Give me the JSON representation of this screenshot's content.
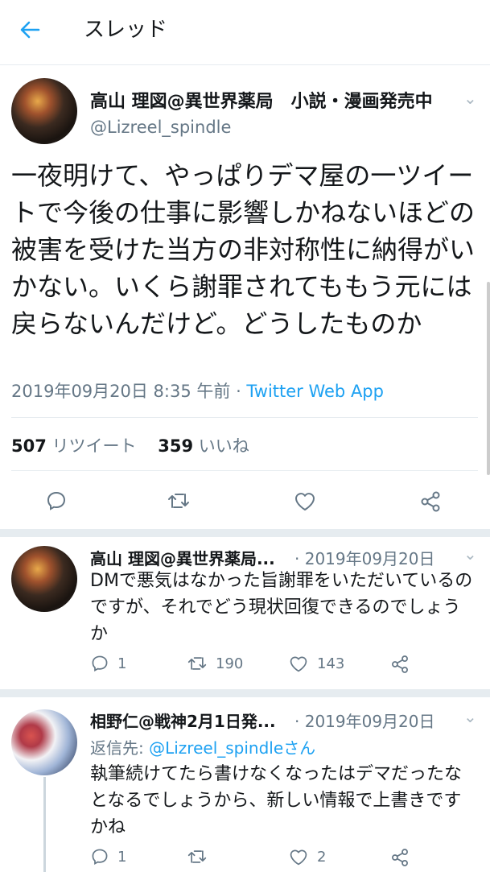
{
  "header": {
    "title": "スレッド"
  },
  "main_tweet": {
    "name": "高山 理図@異世界薬局　小説・漫画発売中",
    "handle": "@Lizreel_spindle",
    "text": "一夜明けて、やっぱりデマ屋の一ツイートで今後の仕事に影響しかねないほどの被害を受けた当方の非対称性に納得がいかない。いくら謝罪されてももう元には戻らないんだけど。どうしたものか",
    "timestamp": "2019年09月20日 8:35 午前 · ",
    "client": "Twitter Web App",
    "retweets_count": "507",
    "retweets_label": "リツイート",
    "likes_count": "359",
    "likes_label": "いいね"
  },
  "replies": [
    {
      "name": "高山 理図@異世界薬局...",
      "date": "· 2019年09月20日",
      "text": "DMで悪気はなかった旨謝罪をいただいているのですが、それでどう現状回復できるのでしょうか",
      "reply_count": "1",
      "retweet_count": "190",
      "like_count": "143"
    },
    {
      "name": "相野仁@戦神2月1日発...",
      "date": "· 2019年09月20日",
      "reply_to_label": "返信先: ",
      "reply_to_handle": "@Lizreel_spindleさん",
      "text": "執筆続けてたら書けなくなったはデマだったなとなるでしょうから、新しい情報で上書きですかね",
      "reply_count": "1",
      "retweet_count": "",
      "like_count": "2"
    }
  ],
  "colors": {
    "accent": "#1da1f2",
    "muted": "#657786",
    "divider": "#e6ecf0"
  }
}
